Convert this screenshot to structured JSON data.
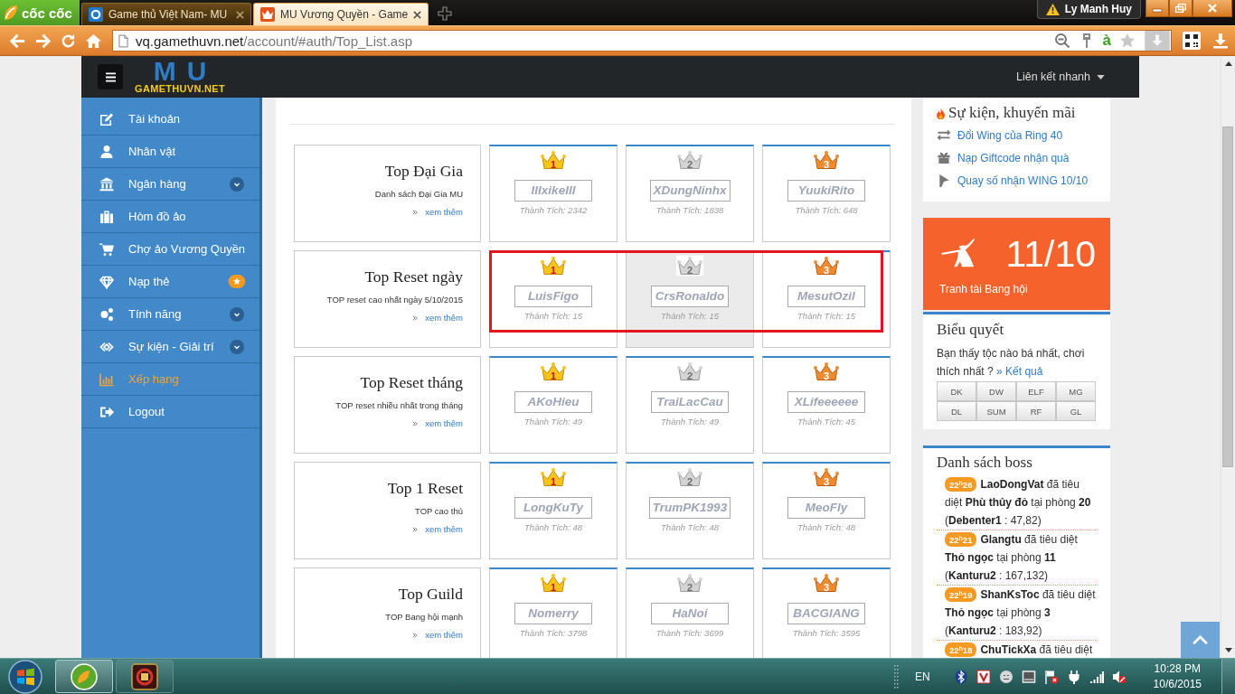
{
  "browser": {
    "brand": "cốc cốc",
    "tabs": [
      {
        "title": "Game thủ Việt Nam- MU",
        "selected": false
      },
      {
        "title": "MU Vương Quyền - Game",
        "selected": true
      }
    ],
    "user": "Ly Manh Huy",
    "address": {
      "host": "vq.gamethuvn.net",
      "path": "/account/#auth/Top_List.asp"
    },
    "input_mode": "à"
  },
  "site": {
    "logo_mark": "MU",
    "logo_text": "GAMETHUVN.NET",
    "quick_links": "Liên kết nhanh"
  },
  "sidebar": {
    "items": [
      {
        "label": "Tài khoản",
        "selected": false,
        "expandable": false,
        "starred": false
      },
      {
        "label": "Nhân vật",
        "selected": false,
        "expandable": false,
        "starred": false
      },
      {
        "label": "Ngân hàng",
        "selected": false,
        "expandable": true,
        "starred": false
      },
      {
        "label": "Hòm đồ ảo",
        "selected": false,
        "expandable": false,
        "starred": false
      },
      {
        "label": "Chợ ảo Vương Quyền",
        "selected": false,
        "expandable": false,
        "starred": false
      },
      {
        "label": "Nạp thẻ",
        "selected": false,
        "expandable": false,
        "starred": true
      },
      {
        "label": "Tính năng",
        "selected": false,
        "expandable": true,
        "starred": false
      },
      {
        "label": "Sự kiện - Giải trí",
        "selected": false,
        "expandable": true,
        "starred": false
      },
      {
        "label": "Xếp hạng",
        "selected": true,
        "expandable": false,
        "starred": false
      },
      {
        "label": "Logout",
        "selected": false,
        "expandable": false,
        "starred": false
      }
    ]
  },
  "rankings": [
    {
      "title": "Top Đại Gia",
      "description": "Danh sách Đại Gia MU",
      "more": "xem thêm",
      "highlighted": true,
      "outlined": false,
      "cards": [
        {
          "kind": "gold",
          "rank": "1",
          "name": "IIIxikeIII",
          "score": "Thành Tích: 2342",
          "hovered": false
        },
        {
          "kind": "silver",
          "rank": "2",
          "name": "XDungNinhx",
          "score": "Thành Tích: 1838",
          "hovered": false
        },
        {
          "kind": "bronze",
          "rank": "3",
          "name": "YuukiRito",
          "score": "Thành Tích: 648",
          "hovered": false
        }
      ]
    },
    {
      "title": "Top Reset ngày",
      "description": "TOP reset cao nhất ngày 5/10/2015",
      "more": "xem thêm",
      "highlighted": true,
      "outlined": true,
      "cards": [
        {
          "kind": "gold",
          "rank": "1",
          "name": "LuisFigo",
          "score": "Thành Tích: 15",
          "hovered": false
        },
        {
          "kind": "silver",
          "rank": "2",
          "name": "CrsRonaldo",
          "score": "Thành Tích: 15",
          "hovered": true
        },
        {
          "kind": "bronze",
          "rank": "3",
          "name": "MesutOzil",
          "score": "Thành Tích: 15",
          "hovered": false
        }
      ]
    },
    {
      "title": "Top Reset tháng",
      "description": "TOP reset nhiều nhất trong tháng",
      "more": "xem thêm",
      "highlighted": true,
      "outlined": false,
      "cards": [
        {
          "kind": "gold",
          "rank": "1",
          "name": "AKoHieu",
          "score": "Thành Tích: 49",
          "hovered": false
        },
        {
          "kind": "silver",
          "rank": "2",
          "name": "TraiLacCau",
          "score": "Thành Tích: 49",
          "hovered": false
        },
        {
          "kind": "bronze",
          "rank": "3",
          "name": "XLifeeeeee",
          "score": "Thành Tích: 45",
          "hovered": false
        }
      ]
    },
    {
      "title": "Top 1 Reset",
      "description": "TOP cao thủ",
      "more": "xem thêm",
      "highlighted": true,
      "outlined": false,
      "cards": [
        {
          "kind": "gold",
          "rank": "1",
          "name": "LongKuTy",
          "score": "Thành Tích: 48",
          "hovered": false
        },
        {
          "kind": "silver",
          "rank": "2",
          "name": "TrumPK1993",
          "score": "Thành Tích: 48",
          "hovered": false
        },
        {
          "kind": "bronze",
          "rank": "3",
          "name": "MeoFly",
          "score": "Thành Tích: 48",
          "hovered": false
        }
      ]
    },
    {
      "title": "Top Guild",
      "description": "TOP Bang hội mạnh",
      "more": "xem thêm",
      "highlighted": true,
      "outlined": false,
      "cards": [
        {
          "kind": "gold",
          "rank": "1",
          "name": "Nomerry",
          "score": "Thành Tích: 3798",
          "hovered": false
        },
        {
          "kind": "silver",
          "rank": "2",
          "name": "HaNoi",
          "score": "Thành Tích: 3699",
          "hovered": false
        },
        {
          "kind": "bronze",
          "rank": "3",
          "name": "BACGIANG",
          "score": "Thành Tích: 3595",
          "hovered": false
        }
      ]
    }
  ],
  "promotions": {
    "title": "Sự kiện, khuyến mãi",
    "links": [
      "Đổi Wing của Ring 40",
      "Nạp Giftcode nhận quà",
      "Quay số nhận WING 10/10"
    ]
  },
  "event_banner": {
    "date": "11/10",
    "label": "Tranh tài Bang hội"
  },
  "poll": {
    "title": "Biểu quyết",
    "question": "Bạn thấy tộc nào bá nhất, chơi thích nhất ?",
    "result_link": "» Kết quả",
    "options": [
      "DK",
      "DW",
      "ELF",
      "MG",
      "DL",
      "SUM",
      "RF",
      "GL"
    ]
  },
  "boss_list": {
    "title": "Danh sách boss",
    "entries": [
      {
        "time": "22$^{h}$26",
        "text": "**LaoDongVat** đã tiêu diệt **Phù thủy đỏ** tại phòng **20** (**Debenter1** : 47,82)"
      },
      {
        "time": "22$^{h}$21",
        "text": "**Glangtu** đã tiêu diệt **Thỏ ngọc** tại phòng **11** (**Kanturu2** : 167,132)"
      },
      {
        "time": "22$^{h}$19",
        "text": "**ShanKsToc** đã tiêu diệt **Thỏ ngọc** tại phòng **3** (**Kanturu2** : 183,92)"
      },
      {
        "time": "22$^{h}$18",
        "text": "**ChuTickXa** đã tiêu diệt"
      }
    ]
  },
  "taskbar": {
    "language": "EN",
    "time": "10:28 PM",
    "date": "10/6/2015"
  }
}
